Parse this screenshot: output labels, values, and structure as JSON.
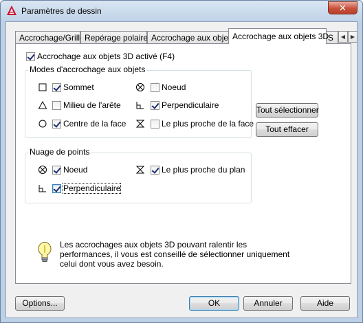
{
  "window": {
    "title": "Paramètres de dessin",
    "close_glyph": "✕"
  },
  "tabs": [
    {
      "label": "Accrochage/Grille",
      "active": false
    },
    {
      "label": "Repérage polaire",
      "active": false
    },
    {
      "label": "Accrochage aux objets",
      "active": false
    },
    {
      "label": "Accrochage aux objets 3D",
      "active": true
    },
    {
      "label": "S",
      "active": false
    }
  ],
  "tab_scroll": {
    "left": "◀",
    "right": "▶"
  },
  "main": {
    "enable_label": "Accrochage aux objets 3D activé (F4)",
    "enable_checked": true
  },
  "modes_group": {
    "title": "Modes d'accrochage aux objets",
    "items": [
      {
        "label": "Sommet",
        "checked": true,
        "symbol": "square-icon"
      },
      {
        "label": "Milieu de l'arête",
        "checked": false,
        "symbol": "triangle-icon"
      },
      {
        "label": "Centre de la face",
        "checked": true,
        "symbol": "circle-icon"
      },
      {
        "label": "Noeud",
        "checked": false,
        "symbol": "node-icon"
      },
      {
        "label": "Perpendiculaire",
        "checked": true,
        "symbol": "perpendicular-icon"
      },
      {
        "label": "Le plus proche de la face",
        "checked": false,
        "symbol": "hourglass-icon"
      }
    ]
  },
  "points_group": {
    "title": "Nuage de points",
    "items": [
      {
        "label": "Noeud",
        "checked": true,
        "symbol": "node-icon"
      },
      {
        "label": "Perpendiculaire",
        "checked": true,
        "symbol": "perpendicular-icon"
      },
      {
        "label": "Le plus proche du plan",
        "checked": true,
        "symbol": "hourglass-icon"
      }
    ]
  },
  "side_buttons": {
    "select_all": "Tout sélectionner",
    "clear_all": "Tout effacer"
  },
  "info": {
    "text": "Les accrochages aux objets 3D pouvant ralentir les performances, il vous est conseillé de sélectionner uniquement celui dont vous avez besoin."
  },
  "footer": {
    "options": "Options...",
    "ok": "OK",
    "cancel": "Annuler",
    "help": "Aide"
  },
  "colors": {
    "title_bar": "#bfd2e7",
    "close_button": "#c7513b",
    "autocad_red": "#c8102e",
    "check_mark": "#1c2f70"
  }
}
